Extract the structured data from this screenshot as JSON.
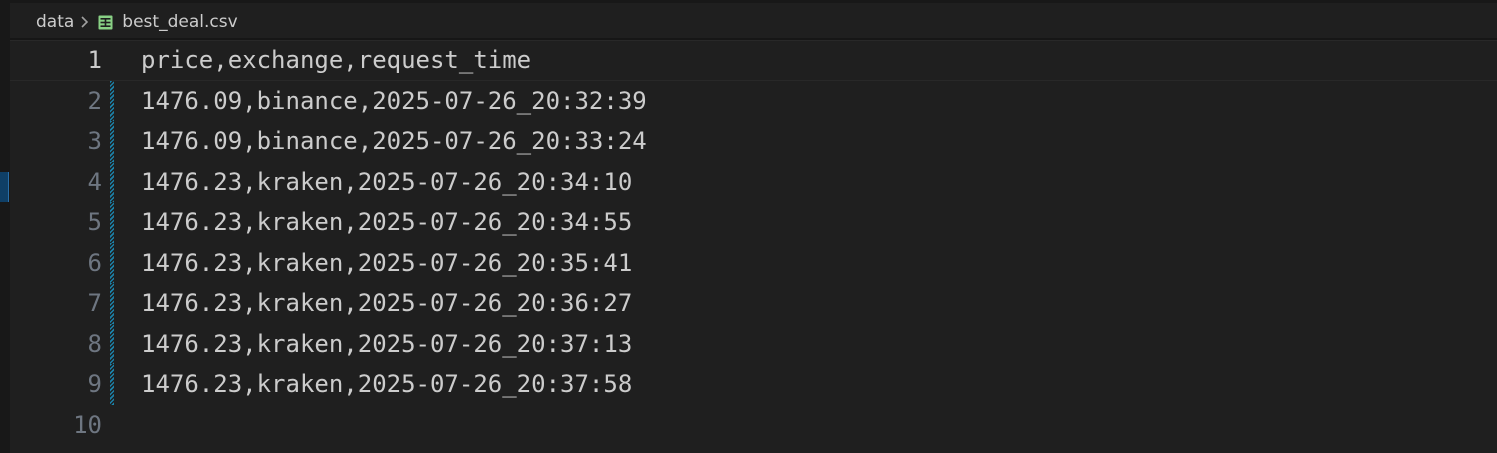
{
  "breadcrumb": {
    "folder": "data",
    "separator_icon": "chevron-right-icon",
    "file_icon": "table-file-icon",
    "file_icon_color": "#89d185",
    "file": "best_deal.csv"
  },
  "editor": {
    "background": "#1f1f1f",
    "modified_gutter_color": "#1b81a8",
    "current_line": 1,
    "lines": [
      {
        "number": "1",
        "text": "price,exchange,request_time",
        "modified": false
      },
      {
        "number": "2",
        "text": "1476.09,binance,2025-07-26_20:32:39",
        "modified": true
      },
      {
        "number": "3",
        "text": "1476.09,binance,2025-07-26_20:33:24",
        "modified": true
      },
      {
        "number": "4",
        "text": "1476.23,kraken,2025-07-26_20:34:10",
        "modified": true
      },
      {
        "number": "5",
        "text": "1476.23,kraken,2025-07-26_20:34:55",
        "modified": true
      },
      {
        "number": "6",
        "text": "1476.23,kraken,2025-07-26_20:35:41",
        "modified": true
      },
      {
        "number": "7",
        "text": "1476.23,kraken,2025-07-26_20:36:27",
        "modified": true
      },
      {
        "number": "8",
        "text": "1476.23,kraken,2025-07-26_20:37:13",
        "modified": true
      },
      {
        "number": "9",
        "text": "1476.23,kraken,2025-07-26_20:37:58",
        "modified": true
      },
      {
        "number": "10",
        "text": "",
        "modified": false
      }
    ]
  }
}
